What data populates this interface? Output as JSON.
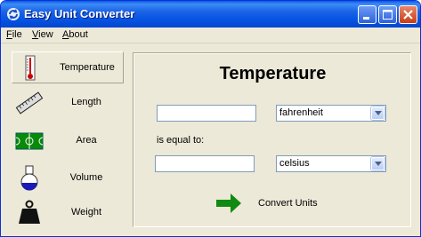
{
  "window": {
    "title": "Easy Unit Converter",
    "title_icon": "refresh-arrows-icon",
    "controls": [
      "minimize-icon",
      "maximize-icon",
      "close-icon"
    ]
  },
  "menu": {
    "items": [
      {
        "label_first": "F",
        "label_rest": "ile"
      },
      {
        "label_first": "V",
        "label_rest": "iew"
      },
      {
        "label_first": "A",
        "label_rest": "bout"
      }
    ]
  },
  "sidebar": {
    "items": [
      {
        "label": "Temperature",
        "icon": "thermometer-icon",
        "selected": true
      },
      {
        "label": "Length",
        "icon": "ruler-icon",
        "selected": false
      },
      {
        "label": "Area",
        "icon": "field-icon",
        "selected": false
      },
      {
        "label": "Volume",
        "icon": "flask-icon",
        "selected": false
      },
      {
        "label": "Weight",
        "icon": "weight-icon",
        "selected": false
      }
    ]
  },
  "main": {
    "heading": "Temperature",
    "from": {
      "value": "",
      "unit": "fahrenheit"
    },
    "equal_label": "is equal to:",
    "to": {
      "value": "",
      "unit": "celsius"
    },
    "convert_label": "Convert Units",
    "convert_icon": "green-arrow-icon"
  },
  "colors": {
    "titlebar": "#0554e2",
    "window_bg": "#ece9d8",
    "convert_arrow": "#118a11"
  }
}
